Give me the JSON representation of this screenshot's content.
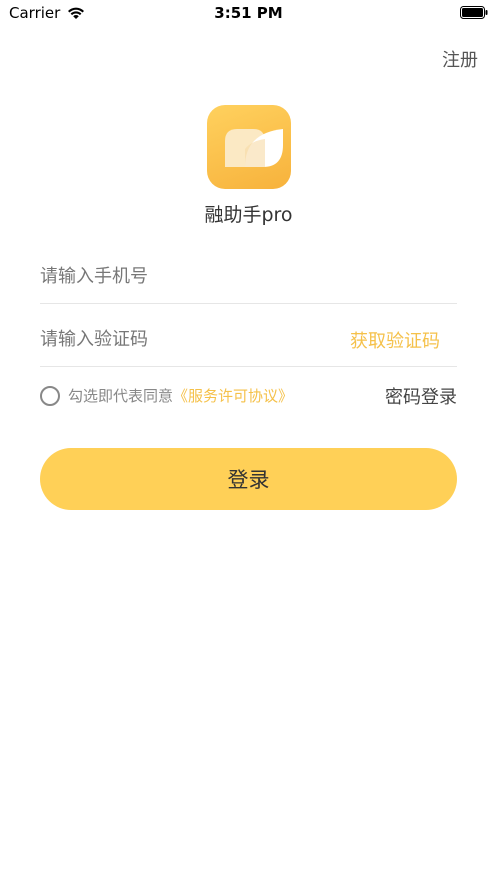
{
  "status_bar": {
    "carrier": "Carrier",
    "time": "3:51 PM"
  },
  "header": {
    "register_label": "注册"
  },
  "app": {
    "name": "融助手pro",
    "logo_colors": [
      "#ffd15e",
      "#f7b23c"
    ]
  },
  "form": {
    "phone_placeholder": "请输入手机号",
    "phone_value": "",
    "code_placeholder": "请输入验证码",
    "code_value": "",
    "get_code_label": "获取验证码"
  },
  "agreement": {
    "checked": false,
    "prefix": "勾选即代表同意",
    "link_text": "《服务许可协议》"
  },
  "password_login_label": "密码登录",
  "login_button_label": "登录",
  "colors": {
    "accent": "#f5c14a",
    "button": "#ffd057"
  }
}
